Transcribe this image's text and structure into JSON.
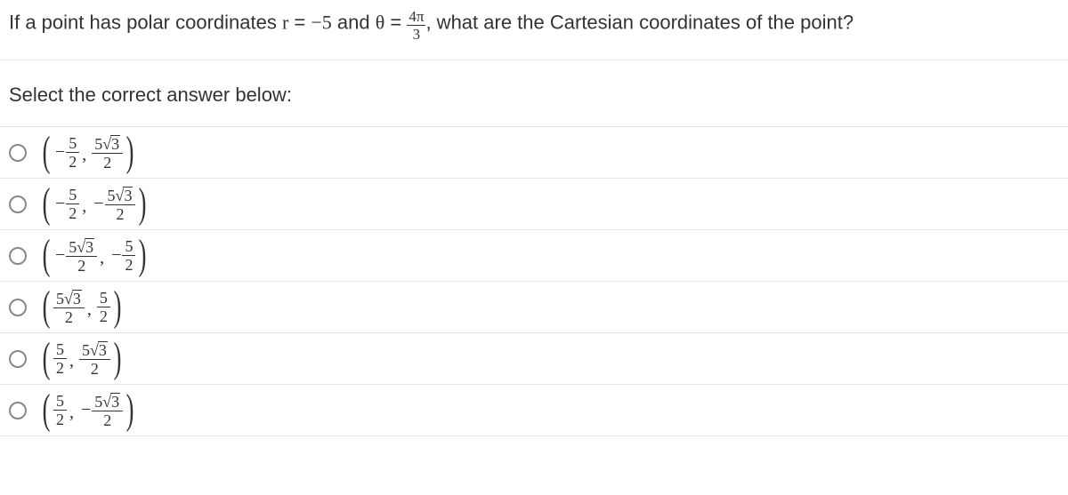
{
  "question": {
    "text_before_r": "If a point has polar coordinates ",
    "r_symbol": "r",
    "equals1": " = ",
    "r_value": "−5",
    "and_text": " and ",
    "theta_symbol": "θ",
    "equals2": " = ",
    "theta_frac_num": "4π",
    "theta_frac_den": "3",
    "text_after": ", what are the Cartesian coordinates of the point?"
  },
  "prompt": "Select the correct answer below:",
  "options": [
    {
      "x_neg": true,
      "x_num": "5",
      "x_sqrt": null,
      "x_den": "2",
      "y_neg": false,
      "y_num": "5",
      "y_sqrt": "3",
      "y_den": "2"
    },
    {
      "x_neg": true,
      "x_num": "5",
      "x_sqrt": null,
      "x_den": "2",
      "y_neg": true,
      "y_num": "5",
      "y_sqrt": "3",
      "y_den": "2"
    },
    {
      "x_neg": true,
      "x_num": "5",
      "x_sqrt": "3",
      "x_den": "2",
      "y_neg": true,
      "y_num": "5",
      "y_sqrt": null,
      "y_den": "2"
    },
    {
      "x_neg": false,
      "x_num": "5",
      "x_sqrt": "3",
      "x_den": "2",
      "y_neg": false,
      "y_num": "5",
      "y_sqrt": null,
      "y_den": "2"
    },
    {
      "x_neg": false,
      "x_num": "5",
      "x_sqrt": null,
      "x_den": "2",
      "y_neg": false,
      "y_num": "5",
      "y_sqrt": "3",
      "y_den": "2"
    },
    {
      "x_neg": false,
      "x_num": "5",
      "x_sqrt": null,
      "x_den": "2",
      "y_neg": true,
      "y_num": "5",
      "y_sqrt": "3",
      "y_den": "2"
    }
  ]
}
